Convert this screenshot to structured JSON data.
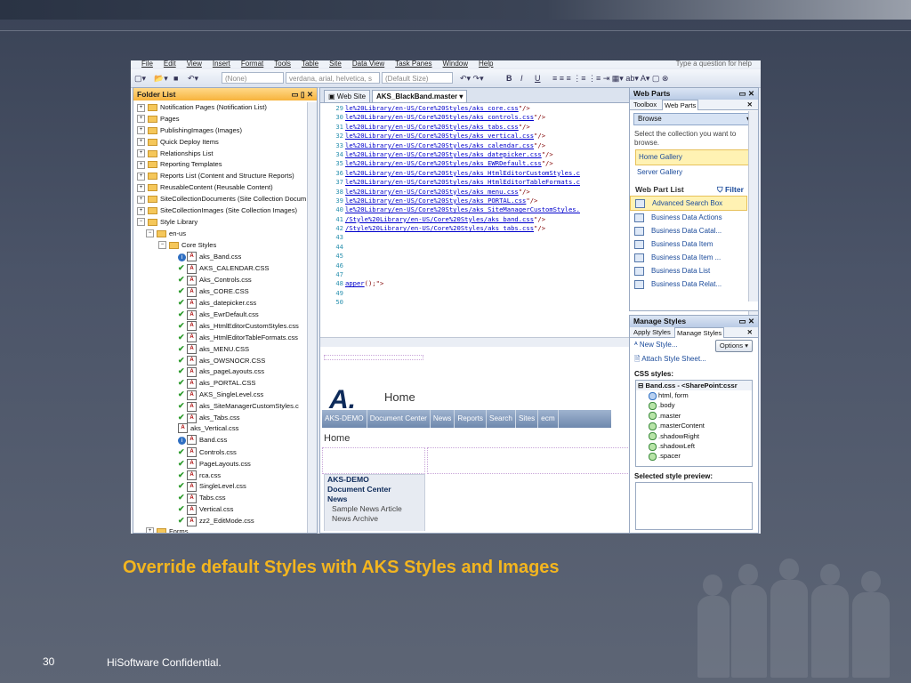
{
  "slide": {
    "headline": "Override default Styles with AKS Styles and Images",
    "page_number": "30",
    "footer": "HiSoftware Confidential."
  },
  "app": {
    "menu": [
      "File",
      "Edit",
      "View",
      "Insert",
      "Format",
      "Tools",
      "Table",
      "Site",
      "Data View",
      "Task Panes",
      "Window",
      "Help"
    ],
    "help_box": "Type a question for help",
    "toolbar": {
      "style_combo": "(None)",
      "font_combo": "verdana, arial, helvetica, s",
      "size_combo": "(Default Size)"
    }
  },
  "folder_list": {
    "title": "Folder List",
    "items": [
      {
        "label": "Notification Pages (Notification List)",
        "type": "list"
      },
      {
        "label": "Pages",
        "type": "lib"
      },
      {
        "label": "PublishingImages (Images)",
        "type": "lib"
      },
      {
        "label": "Quick Deploy Items",
        "type": "list"
      },
      {
        "label": "Relationships List",
        "type": "list"
      },
      {
        "label": "Reporting Templates",
        "type": "lib"
      },
      {
        "label": "Reports List (Content and Structure Reports)",
        "type": "list"
      },
      {
        "label": "ReusableContent (Reusable Content)",
        "type": "list"
      },
      {
        "label": "SiteCollectionDocuments (Site Collection Docum",
        "type": "lib"
      },
      {
        "label": "SiteCollectionImages (Site Collection Images)",
        "type": "lib"
      },
      {
        "label": "Style Library",
        "type": "lib-open"
      },
      {
        "label": "en-us",
        "type": "folder"
      },
      {
        "label": "Core Styles",
        "type": "folder"
      },
      {
        "label": "aks_Band.css",
        "type": "info"
      },
      {
        "label": "AKS_CALENDAR.CSS",
        "type": "check"
      },
      {
        "label": "Aks_Controls.css",
        "type": "check"
      },
      {
        "label": "aks_CORE.CSS",
        "type": "check"
      },
      {
        "label": "aks_datepicker.css",
        "type": "check"
      },
      {
        "label": "aks_EwrDefault.css",
        "type": "check"
      },
      {
        "label": "aks_HtmlEditorCustomStyles.css",
        "type": "check"
      },
      {
        "label": "aks_HtmlEditorTableFormats.css",
        "type": "check"
      },
      {
        "label": "aks_MENU.CSS",
        "type": "check"
      },
      {
        "label": "aks_OWSNOCR.CSS",
        "type": "check"
      },
      {
        "label": "aks_pageLayouts.css",
        "type": "check"
      },
      {
        "label": "aks_PORTAL.CSS",
        "type": "check"
      },
      {
        "label": "AKS_SingleLevel.css",
        "type": "check"
      },
      {
        "label": "aks_SiteManagerCustomStyles.c",
        "type": "check"
      },
      {
        "label": "aks_Tabs.css",
        "type": "check"
      },
      {
        "label": "aks_Vertical.css",
        "type": "plain"
      },
      {
        "label": "Band.css",
        "type": "info"
      },
      {
        "label": "Controls.css",
        "type": "check"
      },
      {
        "label": "PageLayouts.css",
        "type": "check"
      },
      {
        "label": "rca.css",
        "type": "check"
      },
      {
        "label": "SingleLevel.css",
        "type": "check"
      },
      {
        "label": "Tabs.css",
        "type": "check"
      },
      {
        "label": "Vertical.css",
        "type": "check"
      },
      {
        "label": "zz2_EditMode.css",
        "type": "check"
      },
      {
        "label": "Forms",
        "type": "folder-small"
      }
    ]
  },
  "editor": {
    "tabs": [
      "Web Site",
      "AKS_BlackBand.master"
    ],
    "code_lines": [
      {
        "n": "29",
        "t": "le%20Library/en-US/Core%20Styles/aks_core.css",
        "e": "\"/>"
      },
      {
        "n": "30",
        "t": "le%20Library/en-US/Core%20Styles/aks_controls.css",
        "e": "\"/>"
      },
      {
        "n": "31",
        "t": "le%20Library/en-US/Core%20Styles/aks_tabs.css",
        "e": "\"/>"
      },
      {
        "n": "32",
        "t": "le%20Library/en-US/Core%20Styles/aks_vertical.css",
        "e": "\"/>"
      },
      {
        "n": "33",
        "t": "le%20Library/en-US/Core%20Styles/aks_calendar.css",
        "e": "\"/>"
      },
      {
        "n": "34",
        "t": "le%20Library/en-US/Core%20Styles/aks_datepicker.css",
        "e": "\"/>"
      },
      {
        "n": "35",
        "t": "le%20Library/en-US/Core%20Styles/aks_EWRDefault.css",
        "e": "\"/>"
      },
      {
        "n": "36",
        "t": "le%20Library/en-US/Core%20Styles/aks_HtmlEditorCustomStyles.c",
        "e": ""
      },
      {
        "n": "37",
        "t": "le%20Library/en-US/Core%20Styles/aks_HtmlEditorTableFormats.c",
        "e": ""
      },
      {
        "n": "38",
        "t": "le%20Library/en-US/Core%20Styles/aks_menu.css",
        "e": "\"/>"
      },
      {
        "n": "39",
        "t": "le%20Library/en-US/Core%20Styles/aks_PORTAL.css",
        "e": "\"/>"
      },
      {
        "n": "40",
        "t": "le%20Library/en-US/Core%20Styles/aks_SiteManagerCustomStyles.",
        "e": ""
      },
      {
        "n": "41",
        "t": "/Style%20Library/en-US/Core%20Styles/aks_band.css",
        "e": "\"/>"
      },
      {
        "n": "42",
        "t": "/Style%20Library/en-US/Core%20Styles/aks_tabs.css",
        "e": "\"/>"
      },
      {
        "n": "43",
        "t": "",
        "e": ""
      },
      {
        "n": "44",
        "t": "",
        "e": ""
      },
      {
        "n": "45",
        "t": "",
        "e": ""
      },
      {
        "n": "46",
        "t": "",
        "e": ""
      },
      {
        "n": "47",
        "t": "",
        "e": ""
      },
      {
        "n": "48",
        "t": "apper",
        "e": "();\">"
      },
      {
        "n": "49",
        "t": "",
        "e": ""
      },
      {
        "n": "50",
        "t": "",
        "e": ""
      }
    ],
    "design": {
      "home_title": "Home",
      "nav": [
        "AKS-DEMO",
        "Document Center",
        "News",
        "Reports",
        "Search",
        "Sites",
        "ecm"
      ],
      "breadcrumb": "Home",
      "quick_launch": {
        "headings": [
          "AKS-DEMO",
          "Document Center",
          "News"
        ],
        "subitems": [
          "Sample News Article",
          "News Archive"
        ]
      }
    }
  },
  "web_parts": {
    "title": "Web Parts",
    "tabs": [
      "Toolbox",
      "Web Parts"
    ],
    "browse": "Browse",
    "instruction": "Select the collection you want to browse.",
    "galleries": [
      "Home Gallery",
      "Server Gallery"
    ],
    "list_title": "Web Part List",
    "filter": "Filter",
    "items": [
      "Advanced Search Box",
      "Business Data Actions",
      "Business Data Catal...",
      "Business Data Item",
      "Business Data Item ...",
      "Business Data List",
      "Business Data Relat..."
    ]
  },
  "manage_styles": {
    "title": "Manage Styles",
    "tabs": [
      "Apply Styles",
      "Manage Styles"
    ],
    "new_style": "New Style...",
    "options": "Options",
    "attach": "Attach Style Sheet...",
    "css_label": "CSS styles:",
    "sheet": "Band.css - <SharePoint:cssr",
    "rules": [
      "html, form",
      ".body",
      ".master",
      ".masterContent",
      ".shadowRight",
      ".shadowLeft",
      ".spacer"
    ],
    "preview_label": "Selected style preview:"
  }
}
